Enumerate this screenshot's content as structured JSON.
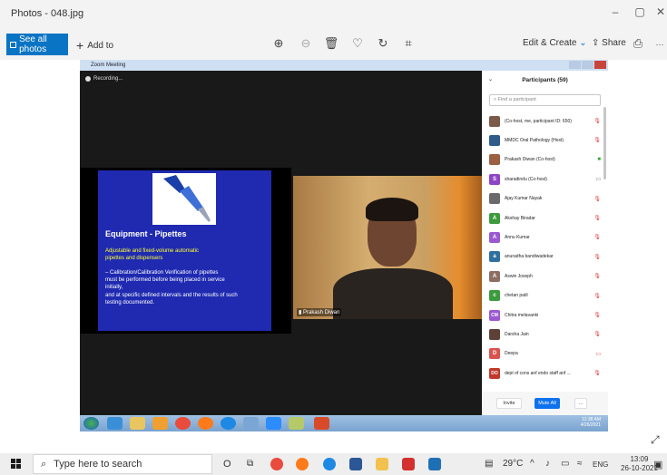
{
  "window": {
    "title": "Photos - 048.jpg",
    "controls": {
      "minimize": "–",
      "maximize": "▢",
      "close": "✕"
    }
  },
  "toolbar": {
    "see_all": "See all photos",
    "add_to": "Add to",
    "add_to_icon": "+",
    "icons": [
      {
        "name": "zoom-in-icon",
        "glyph": "⊕"
      },
      {
        "name": "zoom-out-icon",
        "glyph": "⊖"
      },
      {
        "name": "delete-icon",
        "glyph": "🗑"
      },
      {
        "name": "favorite-icon",
        "glyph": "♡"
      },
      {
        "name": "rotate-icon",
        "glyph": "↻"
      },
      {
        "name": "crop-icon",
        "glyph": "⌗"
      }
    ],
    "edit_create": "Edit & Create",
    "share": "Share",
    "print_icon": "⎙",
    "more_icon": "···"
  },
  "zoom": {
    "window_title": "Zoom Meeting",
    "recording": "Recording...",
    "slide": {
      "heading": "Equipment - Pipettes",
      "lines": [
        "Adjustable and fixed-volume automatic",
        "pipettes and dispensers",
        "– Calibration/Calibration Verification of pipettes",
        "must be performed before being placed in  service",
        "initially,",
        "and at specific defined intervals  and the results of such",
        "testing documented."
      ]
    },
    "camera_name": "Prakash Diwan",
    "participants": {
      "title": "Participants (59)",
      "search_placeholder": "Find a participant",
      "items": [
        {
          "name": "(Co-host, me, participant ID: 650)",
          "avatar": "",
          "color": "#7a5a48"
        },
        {
          "name": "MMDC Oral Pathology (Host)",
          "avatar": "",
          "color": "#2f5b8a"
        },
        {
          "name": "Prakash Diwan (Co-host)",
          "avatar": "",
          "color": "#9a6040"
        },
        {
          "name": "sharadindu (Co-host)",
          "avatar": "S",
          "color": "#8e44c7"
        },
        {
          "name": "Ajay Kumar Nayak",
          "avatar": "",
          "color": "#6a6a6a"
        },
        {
          "name": "Akshay Biradar",
          "avatar": "A",
          "color": "#3d9a3d"
        },
        {
          "name": "Annu Kumar",
          "avatar": "A",
          "color": "#9b59d0"
        },
        {
          "name": "anuradha bandiwadekar",
          "avatar": "a",
          "color": "#2e6f9e"
        },
        {
          "name": "Aswin Joseph",
          "avatar": "A",
          "color": "#8d6e63"
        },
        {
          "name": "chetan patil",
          "avatar": "c",
          "color": "#3d9a3d"
        },
        {
          "name": "Chitra melavanki",
          "avatar": "CM",
          "color": "#9b59d0"
        },
        {
          "name": "Darsha Jain",
          "avatar": "",
          "color": "#5d4037"
        },
        {
          "name": "Deepa",
          "avatar": "D",
          "color": "#d9534f"
        },
        {
          "name": "dept of cons anf endo staff anf ...",
          "avatar": "DO",
          "color": "#c0392b"
        }
      ],
      "invite": "Invite",
      "mute_all": "Mute All",
      "more": "..."
    },
    "win7_clock": {
      "time": "11:38 AM",
      "date": "4/26/2021"
    }
  },
  "taskbar": {
    "search_placeholder": "Type here to search",
    "weather": "29°C",
    "language": "ENG",
    "time": "13:09",
    "date": "26-10-2021"
  }
}
